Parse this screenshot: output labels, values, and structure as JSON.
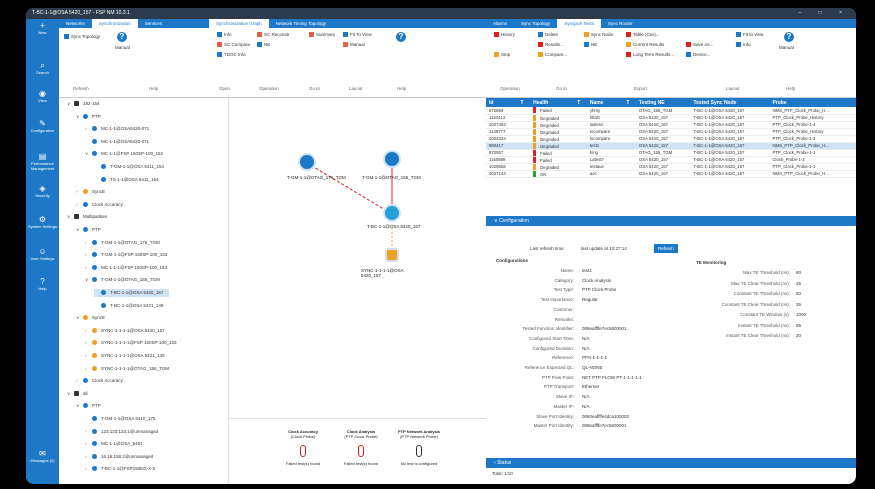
{
  "window": {
    "title": "T-BC-1-1@OSA 5420_157 - FSP NM 10.3.1"
  },
  "nav": [
    {
      "label": "New",
      "icon": "plus-icon"
    },
    {
      "label": "Search",
      "icon": "search-icon"
    },
    {
      "label": "View",
      "icon": "eye-icon"
    },
    {
      "label": "Configuration",
      "icon": "wrench-icon"
    },
    {
      "label": "Performance Management",
      "icon": "chart-icon"
    },
    {
      "label": "Security",
      "icon": "shield-icon"
    },
    {
      "label": "System Settings",
      "icon": "gear-icon"
    },
    {
      "label": "User Settings",
      "icon": "user-icon"
    },
    {
      "label": "Help",
      "icon": "help-icon"
    },
    {
      "label": "Messages (0)",
      "icon": "messages-icon"
    }
  ],
  "tabs_left": [
    "Networks",
    "Synchronization",
    "Services"
  ],
  "tabs_mid": [
    "Synchronization Graph",
    "Network Timing Topology"
  ],
  "tabs_right": [
    "Alarms",
    "Sync Topology",
    "Syncjack Tests",
    "Sync Router"
  ],
  "ribbon_left": {
    "sync_topology": "Sync Topology",
    "manual": "Manual",
    "groups": [
      "Refresh",
      "Help"
    ]
  },
  "ribbon_mid": {
    "items": [
      "Info",
      "SC Compare",
      "TDOC Info",
      "SC Reconstr",
      "NE",
      "Summary",
      "Fit To View",
      "Manual"
    ],
    "groups": [
      "Open",
      "Operation",
      "Go to",
      "Layout",
      "Help"
    ]
  },
  "ribbon_right": {
    "items": [
      "History",
      "Delete",
      "Sync Node",
      "Table (Csv)...",
      "Fit to view",
      "Stop",
      "Results...",
      "NE",
      "Current Results",
      "Save As...",
      "Info",
      "Compare...",
      "Long Term Results...",
      "Device..."
    ],
    "manual": "Manual",
    "groups": [
      "Operation",
      "Go to",
      "Export",
      "Layout",
      "Help"
    ]
  },
  "tree": [
    {
      "label": "192-154",
      "level": 0,
      "icon": "folder-icon",
      "caret": "v"
    },
    {
      "label": "PTP",
      "level": 1,
      "icon": "clock-icon",
      "caret": "v"
    },
    {
      "label": "MC-1-1@OSA5420-071",
      "level": 2,
      "icon": "clock-icon",
      "caret": ">"
    },
    {
      "label": "MC-1-1@OSA5420-071",
      "level": 2,
      "icon": "clock-icon",
      "caret": ""
    },
    {
      "label": "MC-1-1@FSP 150SP-100_152",
      "level": 2,
      "icon": "clock-icon",
      "caret": "v"
    },
    {
      "label": "T-GM-1-1@OSA 5411_154",
      "level": 3,
      "icon": "clock-icon",
      "caret": ""
    },
    {
      "label": "TS-1-1@OSA 5411_154",
      "level": 3,
      "icon": "clock-icon",
      "caret": ""
    },
    {
      "label": "SyncE",
      "level": 1,
      "icon": "sync-icon",
      "caret": ">"
    },
    {
      "label": "Clock Accuracy",
      "level": 1,
      "icon": "clock-icon",
      "caret": ">"
    },
    {
      "label": "Multipartites",
      "level": 0,
      "icon": "folder-icon",
      "caret": "v"
    },
    {
      "label": "PTP",
      "level": 1,
      "icon": "clock-icon",
      "caret": "v"
    },
    {
      "label": "T-GM-1-1@OTAG_176_TGM",
      "level": 2,
      "icon": "clock-icon",
      "caret": ">"
    },
    {
      "label": "T-GM-1-1@FSP 150SP-100_153",
      "level": 2,
      "icon": "clock-icon",
      "caret": ">"
    },
    {
      "label": "MC-1-1-1@FSP 150SP-100_153",
      "level": 2,
      "icon": "clock-icon",
      "caret": ">"
    },
    {
      "label": "T-GM-1-1@OTAG_155_TGM",
      "level": 2,
      "icon": "clock-icon",
      "caret": "v"
    },
    {
      "label": "T-BC-1-1@OSA 5420_157",
      "level": 3,
      "icon": "clock-icon",
      "caret": "",
      "sel": true
    },
    {
      "label": "T-BC-1-1@OSA 5421_149",
      "level": 3,
      "icon": "clock-icon",
      "caret": ""
    },
    {
      "label": "SyncE",
      "level": 1,
      "icon": "sync-icon",
      "caret": "v"
    },
    {
      "label": "SYNC-1-1-1-1@OSA 5420_157",
      "level": 2,
      "icon": "sync-icon",
      "caret": ">"
    },
    {
      "label": "SYNC-1-1-1-1@FSP 150SP-100_153",
      "level": 2,
      "icon": "sync-icon",
      "caret": ">"
    },
    {
      "label": "SYNC-1-1-1-1@OSA 5421_149",
      "level": 2,
      "icon": "sync-icon",
      "caret": ">"
    },
    {
      "label": "SYNC-1-1-1-1@OTAG_155_TGM",
      "level": 2,
      "icon": "sync-icon",
      "caret": ">"
    },
    {
      "label": "Clock Accuracy",
      "level": 1,
      "icon": "clock-icon",
      "caret": ">"
    },
    {
      "label": "all",
      "level": 0,
      "icon": "folder-icon",
      "caret": "v"
    },
    {
      "label": "PTP",
      "level": 1,
      "icon": "clock-icon",
      "caret": "v"
    },
    {
      "label": "T-GM-1-1@OSA 5410_175",
      "level": 2,
      "icon": "clock-icon",
      "caret": ""
    },
    {
      "label": "123.123.123.1@unmanaged",
      "level": 2,
      "icon": "clock-icon",
      "caret": ">"
    },
    {
      "label": "MC-1-1@OSA_5401",
      "level": 2,
      "icon": "clock-icon",
      "caret": ">"
    },
    {
      "label": "16.16.158.2@unmanaged",
      "level": 2,
      "icon": "clock-icon",
      "caret": ">"
    },
    {
      "label": "T-BC-1-1@FSP150EG-X-2",
      "level": 2,
      "icon": "clock-icon",
      "caret": ">"
    }
  ],
  "graph": {
    "nodes": [
      {
        "label": "T-GM-1-1@OTAG_176_TGM"
      },
      {
        "label": "T-GM-1-1@OTAG_155_TGM"
      },
      {
        "label": "T-BC-1-1@OSA 5420_157"
      },
      {
        "label": "SYNC-1-1-1-1@OSA 5420_157"
      }
    ]
  },
  "probes": [
    {
      "title": "Clock Accuracy",
      "sub": "(Clock Probe)",
      "status": "Failed test(s) found"
    },
    {
      "title": "Clock Analysis",
      "sub": "(PTP Clock Probe)",
      "status": "Failed test(s) found"
    },
    {
      "title": "PTP Network Analysis",
      "sub": "(PTP Network Probe)",
      "status": "No test is configured"
    }
  ],
  "grid": {
    "headers": [
      "Id",
      "T",
      "Health",
      "T",
      "Name",
      "T",
      "Testing NE",
      "Tested Sync Node",
      "Probe"
    ],
    "rows": [
      [
        "872859",
        "Failed",
        "yhrsy",
        "OTAG_155_TGM",
        "T-BC-1-1@OSA 5420_157",
        "NMS_PTP_Clock_Probe_H..."
      ],
      [
        "1110413",
        "Degraded",
        "fdtrdt",
        "OSA 5420_157",
        "T-BC-1-1@OSA 5420_157",
        "PTP_Clock_Probe_History"
      ],
      [
        "1027452",
        "Degraded",
        "lasless",
        "OSA 5420_157",
        "T-BC-1-1@OSA 5420_157",
        "PTP_Clock_Probe-1-4"
      ],
      [
        "1149777",
        "Degraded",
        "tocompare",
        "OSA 5420_157",
        "T-BC-1-1@OSA 5420_157",
        "PTP_Clock_Probe_History"
      ],
      [
        "1024324",
        "Degraded",
        "tocompare",
        "OSA 5420_157",
        "T-BC-1-1@OSA 5420_157",
        "PTP_Clock_Probe-1-3"
      ],
      [
        "960417",
        "Degraded",
        "test1",
        "OSA 5420_157",
        "T-BC-1-1@OSA 5420_157",
        "NMS_PTP_Clock_Probe_H..."
      ],
      [
        "872557",
        "Failed",
        "hing",
        "OTAG_155_TGM",
        "T-BC-1-1@OSA 5420_157",
        "PTP_Clock_Probe-1-1"
      ],
      [
        "1150888",
        "Failed",
        "Latest7",
        "OSA 5420_157",
        "T-BC-1-1@OSA 5420_157",
        "Clock_Probe-1-2"
      ],
      [
        "1029558",
        "Degraded",
        "testaue",
        "OSA 5420_157",
        "T-BC-1-1@OSA 5420_157",
        "PTP_Clock_Probe-1-1"
      ],
      [
        "1027144",
        "OK",
        "aoc",
        "OSA 5420_157",
        "T-BC-1-1@OSA 5420_157",
        "NMS_PTP_Clock_Probe_H..."
      ]
    ]
  },
  "config": {
    "header": "Configuration",
    "refresh_label": "Last refresh time:",
    "refresh_value": "last update at 10:27:14",
    "refresh_btn": "Refresh",
    "section": "Configurations",
    "items": [
      [
        "Name:",
        "test1"
      ],
      [
        "Category:",
        "Clock Analysis"
      ],
      [
        "Test Type:",
        "PTP Clock Probe"
      ],
      [
        "Test Importance:",
        "Regular"
      ],
      [
        "Customer:",
        ""
      ],
      [
        "Remarks:",
        ""
      ],
      [
        "Tested Function Identifier:",
        "008eaffffe7ec5600001"
      ],
      [
        "Configured Start Time:",
        "N/A"
      ],
      [
        "Configured Duration:",
        "N/A"
      ],
      [
        "Reference:",
        "PPS-1-1-1-1"
      ],
      [
        "Reference Expected QL:",
        "QL-NONE"
      ],
      [
        "PTP Flow Point:",
        "NET PTP FLOW PT-1-1-1-1-1"
      ],
      [
        "PTP Transport:",
        "Ethernet"
      ],
      [
        "Slave IP:",
        "N/A"
      ],
      [
        "Master IP:",
        "N/A"
      ],
      [
        "Slave Port Identity:",
        "0080eaffffe4dca100002"
      ],
      [
        "Master Port Identity:",
        "008eaffffe7ec5600001"
      ]
    ],
    "te_title": "TE Monitoring",
    "te": [
      [
        "Max TE Threshold (ns):",
        "80"
      ],
      [
        "Max TE Clear Threshold (ns):",
        "25"
      ],
      [
        "Constant TE Threshold (ns):",
        "50"
      ],
      [
        "Constant TE Clear Threshold (ns):",
        "35"
      ],
      [
        "Constant TE Window (s):",
        "1000"
      ],
      [
        "Instant TE Threshold (ns):",
        "85"
      ],
      [
        "Instant TE Clear Threshold (ns):",
        "20"
      ]
    ]
  },
  "status": {
    "header": "Status",
    "total": "Total: 1/10"
  },
  "colors": {
    "accent": "#1e78c8",
    "failed": "#e02020",
    "degraded": "#f0a020",
    "ok": "#2aa02a"
  }
}
